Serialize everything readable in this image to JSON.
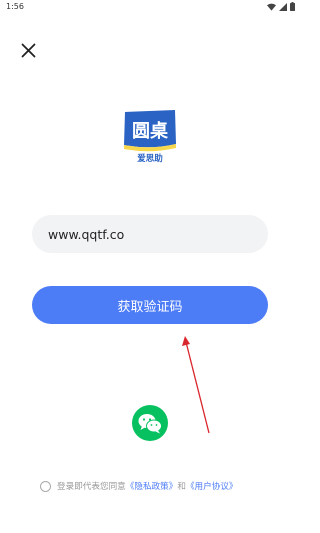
{
  "status_bar": {
    "time": "1:56"
  },
  "logo": {
    "title": "圆桌",
    "subtitle": "爱思助"
  },
  "phone_input": {
    "value": "www.qqtf.co"
  },
  "get_code_button": {
    "label": "获取验证码"
  },
  "wechat_login": {
    "icon": "wechat-icon"
  },
  "agreement": {
    "prefix": "登录即代表您同意",
    "privacy_link": "《隐私政策》",
    "and": "和",
    "user_link": "《用户协议》"
  },
  "colors": {
    "primary": "#4d7cf7",
    "wechat": "#07c160",
    "arrow": "#d9252c"
  }
}
